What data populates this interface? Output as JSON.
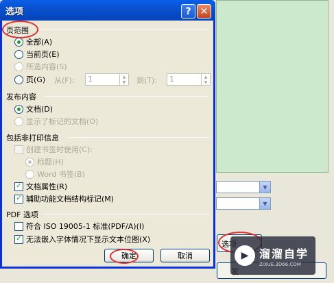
{
  "dialog": {
    "title": "选项",
    "help_label": "?",
    "close_label": "✕"
  },
  "page_range": {
    "heading": "页范围",
    "all": "全部(A)",
    "current": "当前页(E)",
    "selection": "所选内容(S)",
    "pages": "页(G)",
    "from_label": "从(F):",
    "from_value": "1",
    "to_label": "到(T):",
    "to_value": "1"
  },
  "publish": {
    "heading": "发布内容",
    "document": "文档(D)",
    "markup": "显示了标记的文档(O)"
  },
  "nonprint": {
    "heading": "包括非打印信息",
    "bookmarks": "创建书签时使用(C):",
    "headings": "标题(H)",
    "word_bookmarks": "Word 书签(B)",
    "properties": "文档属性(R)",
    "structure_tags": "辅助功能文档结构标记(M)"
  },
  "pdf": {
    "heading": "PDF 选项",
    "iso": "符合 ISO 19005-1 标准(PDF/A)(I)",
    "bitmap": "无法嵌入字体情况下显示文本位图(X)"
  },
  "buttons": {
    "ok": "确定",
    "cancel": "取消"
  },
  "background": {
    "options_button": "选项",
    "ok_button": "发"
  },
  "watermark": {
    "logo": "▶",
    "title": "溜溜自学",
    "url": "ZIXUE.3D66.COM"
  }
}
